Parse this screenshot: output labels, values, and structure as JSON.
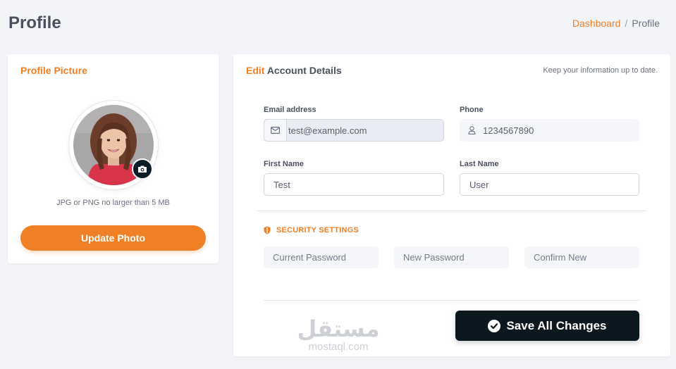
{
  "header": {
    "title": "Profile",
    "breadcrumb": {
      "link": "Dashboard",
      "separator": "/",
      "current": "Profile"
    }
  },
  "picture_card": {
    "title": "Profile Picture",
    "hint": "JPG or PNG no larger than 5 MB",
    "button_label": "Update Photo"
  },
  "details_card": {
    "title_accent": "Edit",
    "title_rest": " Account Details",
    "hint": "Keep your information up to date.",
    "email": {
      "label": "Email address",
      "value": "test@example.com"
    },
    "phone": {
      "label": "Phone",
      "value": "1234567890"
    },
    "first_name": {
      "label": "First Name",
      "value": "Test"
    },
    "last_name": {
      "label": "Last Name",
      "value": "User"
    },
    "security": {
      "title": "SECURITY SETTINGS",
      "current_placeholder": "Current Password",
      "new_placeholder": "New Password",
      "confirm_placeholder": "Confirm New"
    },
    "save_label": "Save All Changes"
  },
  "watermark": {
    "arabic": "مستقل",
    "latin": "mostaql.com"
  },
  "colors": {
    "accent": "#f07f24",
    "dark_button": "#0c1820",
    "background": "#f3f4f8"
  },
  "icons": [
    "camera-icon",
    "mail-icon",
    "user-icon",
    "shield-icon",
    "check-circle-icon"
  ]
}
